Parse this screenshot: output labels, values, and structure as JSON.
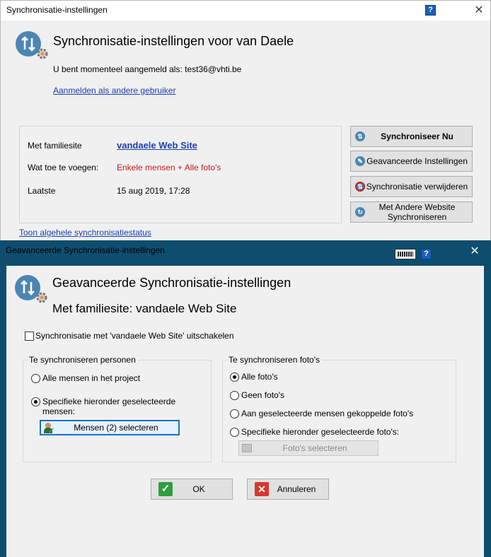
{
  "main_window": {
    "title": "Synchronisatie-instellingen",
    "help_label": "?",
    "close_label": "✕",
    "heading": "Synchronisatie-instellingen voor van Daele",
    "logged_in_text": "U bent momenteel aangemeld als: test36@vhti.be",
    "switch_user_link": "Aanmelden als andere gebruiker",
    "info": {
      "site_label": "Met familiesite",
      "site_value": "vandaele Web Site",
      "add_label": "Wat toe te voegen:",
      "add_value": "Enkele mensen + Alle foto's",
      "last_label": "Laatste",
      "last_value": "15 aug 2019, 17:28"
    },
    "actions": {
      "sync_now": "Synchroniseer Nu",
      "advanced": "Geavanceerde Instellingen",
      "remove": "Synchronisatie verwijderen",
      "other_site": "Met Andere Website Synchroniseren"
    },
    "status_link": "Toon algehele synchronisatiestatus"
  },
  "dialog": {
    "title": "Geavanceerde Synchronisatie-instellingen",
    "help_label": "?",
    "close_label": "✕",
    "heading": "Geavanceerde Synchronisatie-instellingen",
    "subheading": "Met familiesite: vandaele Web Site",
    "disable_checkbox_label": "Synchronisatie met 'vandaele Web Site' uitschakelen",
    "disable_checked": false,
    "persons_group": {
      "legend": "Te synchroniseren personen",
      "option_all": "Alle mensen in het project",
      "option_specific": "Specifieke hieronder geselecteerde mensen:",
      "selected": "specific",
      "select_button": "Mensen (2) selecteren"
    },
    "photos_group": {
      "legend": "Te synchroniseren foto's",
      "option_all": "Alle foto's",
      "option_none": "Geen foto's",
      "option_linked": "Aan geselecteerde mensen gekoppelde foto's",
      "option_specific": "Specifieke hieronder geselecteerde foto's:",
      "selected": "all",
      "select_button": "Foto's selecteren"
    },
    "ok_button": "OK",
    "cancel_button": "Annuleren"
  },
  "colors": {
    "link": "#1a3fb0",
    "warning_text": "#d0181e",
    "dialog_frame": "#0e4d6e",
    "help_button": "#1a5fb4"
  }
}
